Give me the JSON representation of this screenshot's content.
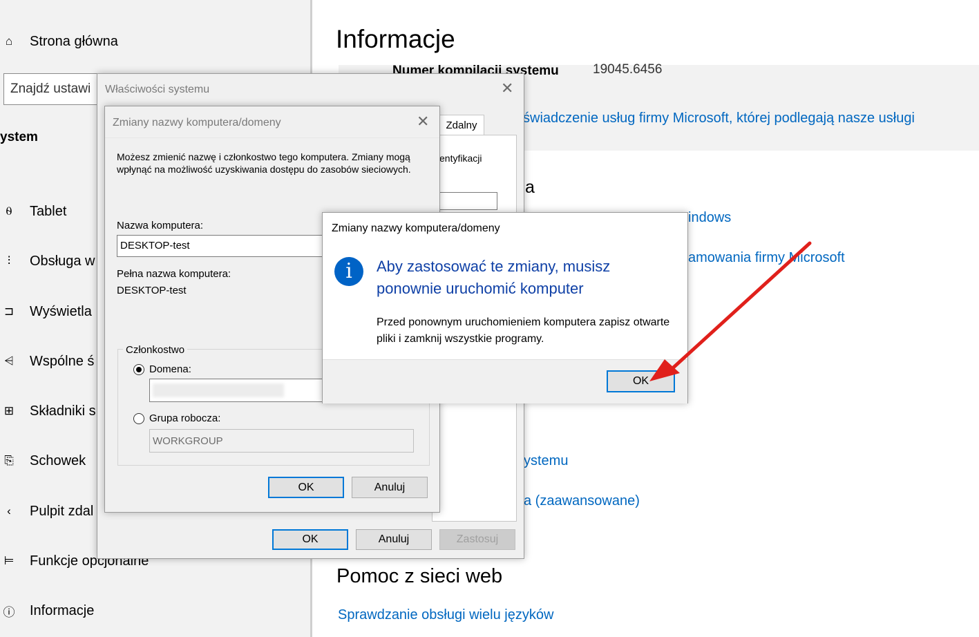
{
  "sidebar": {
    "home": {
      "label": "Strona główna",
      "icon": "home-icon"
    },
    "search_placeholder": "Znajdź ustawi",
    "section_title": "ystem",
    "items": [
      {
        "label": "Tablet",
        "icon": "tablet-icon"
      },
      {
        "label": "Obsługa w",
        "icon": "multitasking-icon"
      },
      {
        "label": "Wyświetla",
        "icon": "projecting-icon"
      },
      {
        "label": "Wspólne ś",
        "icon": "share-icon"
      },
      {
        "label": "Składniki s",
        "icon": "components-icon"
      },
      {
        "label": "Schowek",
        "icon": "clipboard-icon"
      },
      {
        "label": "Pulpit zdal",
        "icon": "remote-desktop-icon"
      },
      {
        "label": "Funkcje opcjonalne",
        "icon": "optional-features-icon"
      },
      {
        "label": "Informacje",
        "icon": "info-icon"
      }
    ]
  },
  "main": {
    "title": "Informacje",
    "build_label": "Numer  kompilacji  systemu",
    "build_value": "19045.6456",
    "links": {
      "services_agreement": "świadczenie usług firmy Microsoft, której podlegają nasze usługi",
      "windows": "indows",
      "software_license": "amowania firmy Microsoft",
      "system_protection": "ystemu",
      "advanced": "a (zaawansowane)",
      "multi_language": "Sprawdzanie obsługi wielu języków"
    },
    "partial_heading": "a",
    "web_help_heading": "Pomoc z sieci web"
  },
  "system_properties": {
    "title": "Właściwości systemu",
    "tab_remote": "Zdalny",
    "partial_text": "entyfikacji",
    "ok": "OK",
    "cancel": "Anuluj",
    "apply": "Zastosuj"
  },
  "rename_dialog": {
    "title": "Zmiany nazwy komputera/domeny",
    "description": "Możesz zmienić nazwę i członkostwo tego komputera. Zmiany mogą wpłynąć na możliwość uzyskiwania dostępu do zasobów sieciowych.",
    "computer_name_label": "Nazwa komputera:",
    "computer_name_value": "DESKTOP-test",
    "full_name_label": "Pełna nazwa komputera:",
    "full_name_value": "DESKTOP-test",
    "membership_label": "Członkostwo",
    "domain_label": "Domena:",
    "workgroup_label": "Grupa robocza:",
    "workgroup_value": "WORKGROUP",
    "ok": "OK",
    "cancel": "Anuluj"
  },
  "restart_dialog": {
    "title": "Zmiany nazwy komputera/domeny",
    "heading": "Aby zastosować te zmiany, musisz ponownie uruchomić komputer",
    "body": "Przed ponownym uruchomieniem komputera zapisz otwarte pliki i zamknij wszystkie programy.",
    "ok": "OK"
  },
  "colors": {
    "link": "#0067c0",
    "accent": "#0078d7",
    "info_icon": "#0063c6",
    "arrow": "#e0201b"
  }
}
